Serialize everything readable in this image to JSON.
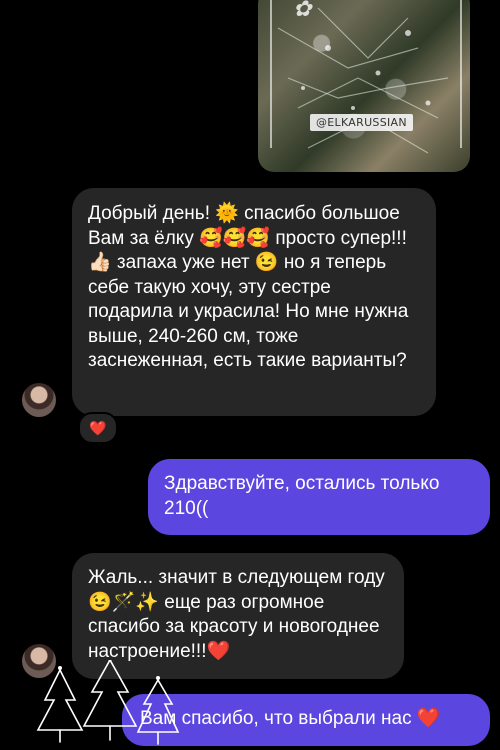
{
  "shared_image": {
    "caption": "@ELKARUSSIAN"
  },
  "messages": {
    "incoming_1": "Добрый день! 🌞 спасибо большое Вам за ёлку 🥰🥰🥰 просто супер!!!👍🏻 запаха уже нет 😉 но я теперь себе такую хочу, эту сестре подарила и украсила! Но мне нужна выше, 240-260 см, тоже заснеженная, есть такие варианты?",
    "reaction_1": "❤️",
    "outgoing_1": "Здравствуйте, остались только 210((",
    "incoming_2": "Жаль... значит в следующем году 😉🪄✨ еще раз огромное спасибо за красоту и новогоднее настроение!!!❤️",
    "outgoing_2": "Вам спасибо, что выбрали нас ❤️"
  },
  "colors": {
    "background": "#000000",
    "incoming_bubble": "#262626",
    "outgoing_bubble": "#5b47e0",
    "heart": "#e5243b"
  },
  "icons": [
    "heart-icon",
    "christmas-tree-icon"
  ]
}
